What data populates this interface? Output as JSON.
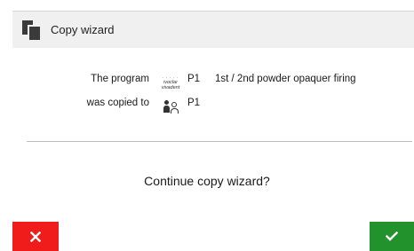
{
  "header": {
    "title": "Copy wizard",
    "icon": "copy-icon"
  },
  "copy_info": {
    "program_label": "The program",
    "source_logo_text_top": "ivoclar",
    "source_logo_text_bottom": "vivadent",
    "program_id": "P1",
    "program_name": "1st / 2nd powder opaquer firing",
    "copied_label": "was copied to",
    "target_icon": "user-profile-icon",
    "target_program_id": "P1"
  },
  "prompt": {
    "question": "Continue copy wizard?"
  },
  "buttons": {
    "cancel_icon": "close-icon",
    "cancel_color": "#f01c1c",
    "confirm_icon": "checkmark-icon",
    "confirm_color": "#22922c"
  }
}
